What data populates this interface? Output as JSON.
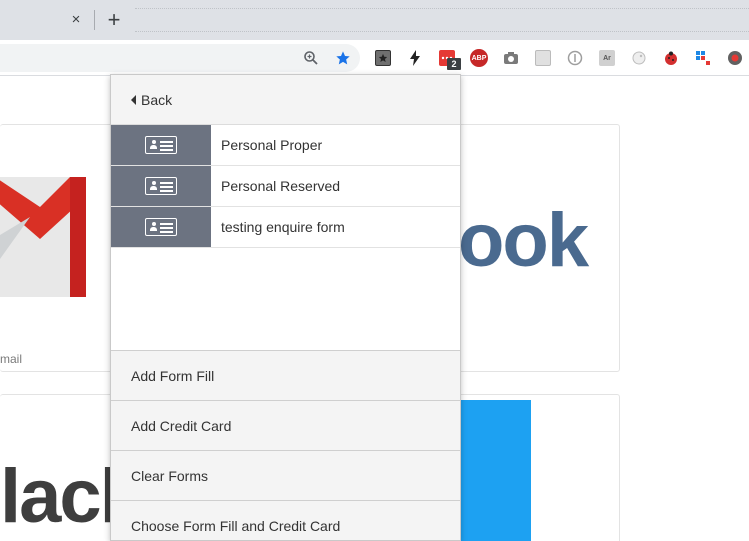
{
  "browser": {
    "tab_close_glyph": "×",
    "new_tab_glyph": "+",
    "toolbar_icons": [
      "zoom-icon",
      "bookmark-star-icon",
      "ext-bookmark-icon",
      "ext-lightning-icon",
      "ext-roboform-icon",
      "ext-adblock-icon",
      "ext-camera-icon",
      "ext-gray-icon",
      "ext-circle-icon",
      "ext-text-icon",
      "ext-moon-icon",
      "ext-ladybug-icon",
      "ext-grid-icon",
      "ext-record-icon"
    ],
    "adblock_label": "ABP",
    "ext_text_label": "Ar",
    "roboform_badge": "2",
    "accent_star": "#1a73e8"
  },
  "page": {
    "gmail_label": "mail",
    "facebook_partial": "ook",
    "slack_partial": "lacl"
  },
  "popup": {
    "back_label": "Back",
    "forms": [
      {
        "label": "Personal Proper"
      },
      {
        "label": "Personal Reserved"
      },
      {
        "label": "testing enquire form"
      }
    ],
    "actions": [
      {
        "label": "Add Form Fill"
      },
      {
        "label": "Add Credit Card"
      },
      {
        "label": "Clear Forms"
      },
      {
        "label": "Choose Form Fill and Credit Card"
      }
    ],
    "icon_cell_color": "#6c7381"
  }
}
